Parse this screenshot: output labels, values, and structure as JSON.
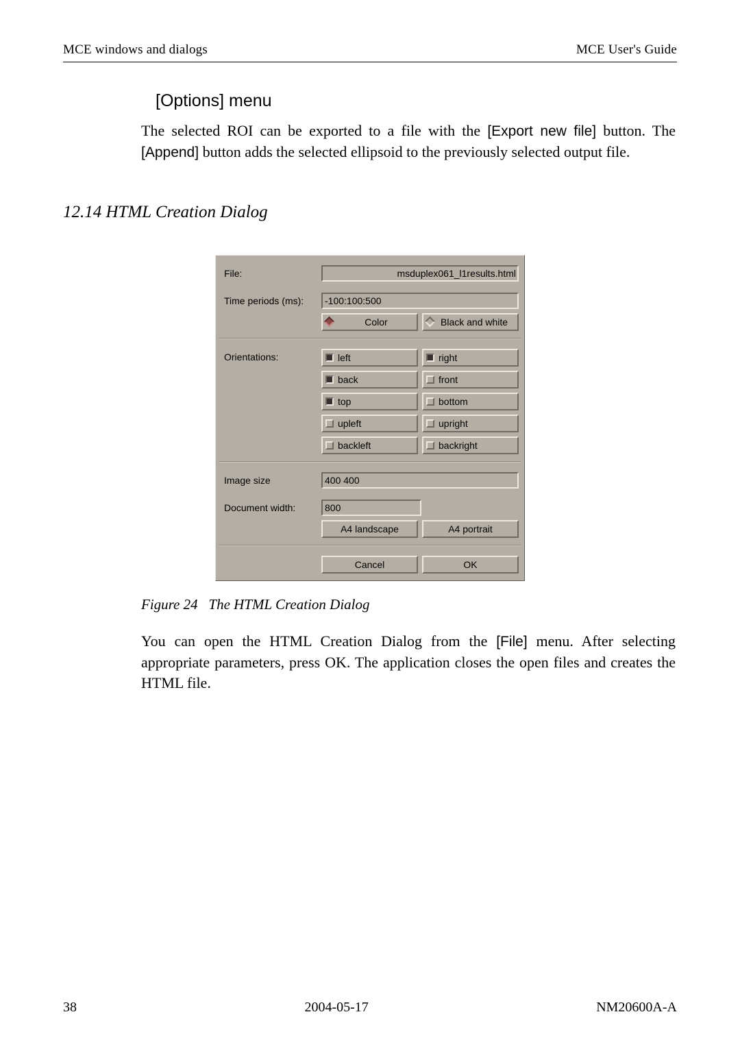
{
  "header": {
    "left": "MCE windows and dialogs",
    "right": "MCE User's Guide"
  },
  "section_options_title": "[Options] menu",
  "options_para_prefix": "The selected ROI can be exported to a file with the ",
  "options_export_btn": "[Export new file]",
  "options_para_mid": " button. The ",
  "options_append_btn": "[Append]",
  "options_para_suffix": " button adds the selected ellipsoid to the previously selected output file.",
  "section_html_title": "12.14  HTML Creation Dialog",
  "dialog": {
    "file_label": "File:",
    "file_value": "msduplex061_l1results.html",
    "time_label": "Time periods (ms):",
    "time_value": "-100:100:500",
    "color_btn": "Color",
    "bw_btn": "Black and white",
    "orientations_label": "Orientations:",
    "orients": {
      "left": "left",
      "right": "right",
      "back": "back",
      "front": "front",
      "top": "top",
      "bottom": "bottom",
      "upleft": "upleft",
      "upright": "upright",
      "backleft": "backleft",
      "backright": "backright"
    },
    "image_size_label": "Image size",
    "image_size_value": "400 400",
    "doc_width_label": "Document width:",
    "doc_width_value": "800",
    "a4_landscape": "A4 landscape",
    "a4_portrait": "A4 portrait",
    "cancel": "Cancel",
    "ok": "OK"
  },
  "figure_caption_prefix": "Figure 24",
  "figure_caption_text": "The HTML Creation Dialog",
  "closing_para_prefix": "You can open the HTML Creation Dialog from the ",
  "closing_file_menu": "[File]",
  "closing_para_suffix": " menu. After selecting appropriate parameters, press OK. The application closes the open files and creates the HTML file.",
  "footer": {
    "page": "38",
    "date": "2004-05-17",
    "doc": "NM20600A-A"
  }
}
